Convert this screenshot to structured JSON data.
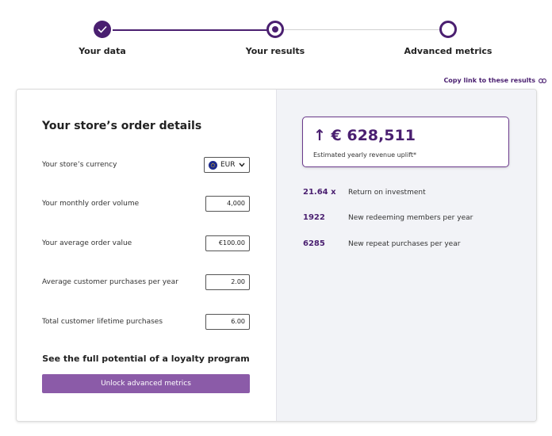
{
  "stepper": {
    "steps": [
      {
        "label": "Your data",
        "state": "completed"
      },
      {
        "label": "Your results",
        "state": "current"
      },
      {
        "label": "Advanced metrics",
        "state": "upcoming"
      }
    ]
  },
  "copy_link": {
    "label": "Copy link to these results",
    "icon": "link-icon"
  },
  "order_details": {
    "title": "Your store’s order details",
    "currency": {
      "label": "Your store’s currency",
      "value": "EUR",
      "icon": "eu-flag-icon"
    },
    "fields": [
      {
        "label": "Your monthly order volume",
        "value": "4,000"
      },
      {
        "label": "Your average order value",
        "value": "€100.00"
      },
      {
        "label": "Average customer purchases per year",
        "value": "2.00"
      },
      {
        "label": "Total customer lifetime purchases",
        "value": "6.00"
      }
    ],
    "promo_text": "See the full potential of a loyalty program",
    "unlock_button": "Unlock advanced metrics"
  },
  "results": {
    "revenue_value": "↑ € 628,511",
    "revenue_caption": "Estimated yearly revenue uplift*",
    "metrics": [
      {
        "value": "21.64 x",
        "label": "Return on investment"
      },
      {
        "value": "1922",
        "label": "New redeeming members per year"
      },
      {
        "value": "6285",
        "label": "New repeat purchases per year"
      }
    ]
  },
  "colors": {
    "accent": "#4a1f70",
    "button": "#8b5ba8",
    "panel_bg": "#f2f3f7"
  }
}
